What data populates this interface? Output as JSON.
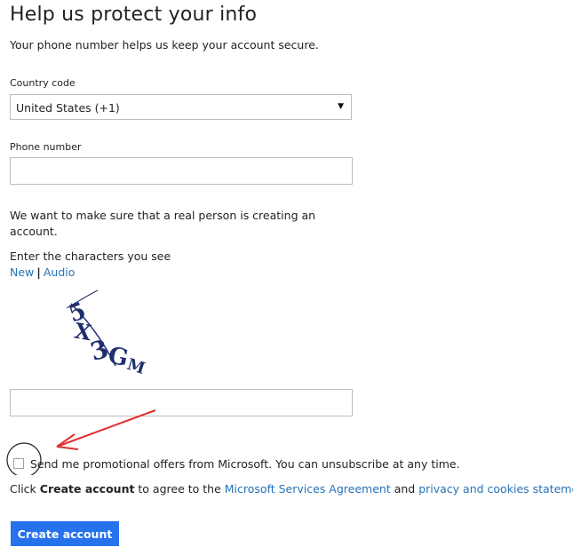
{
  "header": {
    "title": "Help us protect your info",
    "subtitle": "Your phone number helps us keep your account secure."
  },
  "country": {
    "label": "Country code",
    "selected": "United States (+1)"
  },
  "phone": {
    "label": "Phone number",
    "value": ""
  },
  "captcha": {
    "intro": "We want to make sure that a real person is creating an account.",
    "instruction": "Enter the characters you see",
    "new_link": "New",
    "separator": "|",
    "audio_link": "Audio",
    "image_text": "5X3GM",
    "value": ""
  },
  "promo": {
    "label": "Send me promotional offers from Microsoft. You can unsubscribe at any time.",
    "checked": false
  },
  "agreement": {
    "prefix": "Click ",
    "button_ref": "Create account",
    "middle": " to agree to the ",
    "msa_link": "Microsoft Services Agreement",
    "and": " and ",
    "privacy_link": "privacy and cookies statement",
    "suffix": "."
  },
  "actions": {
    "create_label": "Create account"
  },
  "colors": {
    "accent": "#2672ec",
    "link": "#2672b8",
    "annotation_arrow": "#e03030"
  }
}
